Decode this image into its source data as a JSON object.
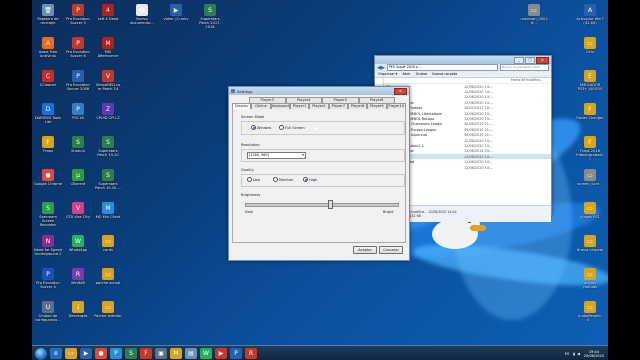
{
  "desktop": {
    "icons": [
      {
        "label": "Papelera de reciclaje",
        "glyph": "🗑",
        "color": "#6a8fb8"
      },
      {
        "label": "Avast Free Antivirus",
        "glyph": "A",
        "color": "#e86a1a"
      },
      {
        "label": "CCleaner",
        "glyph": "C",
        "color": "#c92a2a"
      },
      {
        "label": "DAEMON Tools Lite",
        "glyph": "D",
        "color": "#1d6fd8"
      },
      {
        "label": "Fraps",
        "glyph": "F",
        "color": "#d8a31d"
      },
      {
        "label": "Google Chrome",
        "glyph": "●",
        "color": "#e04a3a"
      },
      {
        "label": "Ssecream Screen Recorder",
        "glyph": "S",
        "color": "#2e9c4c"
      },
      {
        "label": "Need for Speed Underground 2",
        "glyph": "N",
        "color": "#8b2b8b"
      },
      {
        "label": "Pro Evolution Soccer 4",
        "glyph": "P",
        "color": "#1d4fb8"
      },
      {
        "label": "Unidad de configuracio...",
        "glyph": "U",
        "color": "#5a6f8a"
      },
      {
        "label": "Pro Evolution Soccer 5",
        "glyph": "P",
        "color": "#c0392b"
      },
      {
        "label": "Pro Evolution Soccer 6",
        "glyph": "P",
        "color": "#c0392b"
      },
      {
        "label": "Pro Evolution Soccer 2008",
        "glyph": "P",
        "color": "#2a5fb0"
      },
      {
        "label": "PSC16",
        "glyph": "P",
        "color": "#3a7ac0"
      },
      {
        "label": "Shotcut",
        "glyph": "S",
        "color": "#2f7d4f"
      },
      {
        "label": "uTorrent",
        "glyph": "µ",
        "color": "#2f9c3c"
      },
      {
        "label": "GTA Vice City",
        "glyph": "V",
        "color": "#d63c8f"
      },
      {
        "label": "WhatsApp",
        "glyph": "W",
        "color": "#25b05a"
      },
      {
        "label": "WinRAR",
        "glyph": "R",
        "color": "#7a3ab0"
      },
      {
        "label": "Descargas",
        "glyph": "↓",
        "color": "#d8a31d"
      },
      {
        "label": "Left 4 Dead",
        "glyph": "4",
        "color": "#b02020"
      },
      {
        "label": "MSI Afterburner",
        "glyph": "M",
        "color": "#b02020"
      },
      {
        "label": "VirtualRED.com Patch 14",
        "glyph": "V",
        "color": "#c0392b"
      },
      {
        "label": "CPUID CPU-Z",
        "glyph": "Z",
        "color": "#5a3ab0"
      },
      {
        "label": "Superstars Patch 19-20",
        "glyph": "S",
        "color": "#2f7d4f"
      },
      {
        "label": "Superstars Patch 19-20 ...",
        "glyph": "S",
        "color": "#2f7d4f"
      },
      {
        "label": "MO Mix Client",
        "glyph": "M",
        "color": "#2a8fd8"
      },
      {
        "label": "cards",
        "glyph": "▭",
        "color": "#d8a31d"
      },
      {
        "label": "parche actual",
        "glyph": "▭",
        "color": "#d8a31d"
      },
      {
        "label": "Parche anterior",
        "glyph": "▭",
        "color": "#d8a31d"
      },
      {
        "label": "Nuevo documento...",
        "glyph": "▤",
        "color": "#e8e8e8"
      },
      {
        "label": "video (1).mkv",
        "glyph": "▶",
        "color": "#2a5fb0"
      },
      {
        "label": "Superstars Patch 2017-2018",
        "glyph": "S",
        "color": "#2f7d4f"
      },
      {
        "label": "unknown_00026...",
        "glyph": "▭",
        "color": "#8a8a8a"
      },
      {
        "label": "Activador Win7 (32-64)",
        "glyph": "A",
        "color": "#2a5fb0"
      },
      {
        "label": "Celu",
        "glyph": "▭",
        "color": "#d8a31d"
      },
      {
        "label": "EMULADOR PS3+ JUEGOS",
        "glyph": "E",
        "color": "#d8a31d"
      },
      {
        "label": "Folder Changer",
        "glyph": "F",
        "color": "#d8a31d"
      },
      {
        "label": "Fraps 2018 Ribbongrabadi...",
        "glyph": "F",
        "color": "#d8a31d"
      },
      {
        "label": "screen_Scre...",
        "glyph": "▭",
        "color": "#8a8a8a"
      },
      {
        "label": "Juegos PS1",
        "glyph": "▭",
        "color": "#d8a31d"
      },
      {
        "label": "Nueva carpeta",
        "glyph": "▭",
        "color": "#d8a31d"
      },
      {
        "label": "arenas youtube",
        "glyph": "▭",
        "color": "#d8a31d"
      },
      {
        "label": "AudioReader-0...",
        "glyph": "▭",
        "color": "#d8a31d"
      }
    ]
  },
  "settings_window": {
    "title": "Settings",
    "tabs_row1": [
      "Player3",
      "Player4",
      "Player5",
      "Player6"
    ],
    "tabs_row2": [
      "Display",
      "Online",
      "keyboard",
      "Player1",
      "Player2",
      "Player7",
      "Player8",
      "Player9",
      "Player10"
    ],
    "screen_mode": {
      "label": "Screen Mode",
      "options": [
        "Window",
        "Full Screen"
      ],
      "selected": 0
    },
    "resolution": {
      "label": "Resolution",
      "value": "1280, 960"
    },
    "quality": {
      "label": "Quality",
      "options": [
        "Low",
        "Medium",
        "High"
      ],
      "selected": 2
    },
    "brightness": {
      "label": "Brightness",
      "min_label": "Dark",
      "max_label": "Bright",
      "value": 0.55
    },
    "buttons": {
      "ok": "Aceptar",
      "cancel": "Cancelar"
    }
  },
  "explorer": {
    "path": "PES Suple 2020 ▸ ...",
    "search_placeholder": "Buscar Suplemento 2020",
    "toolbar": [
      "Organizar ▾",
      "Abrir",
      "Grabar",
      "Nueva carpeta"
    ],
    "column_header": "Fecha de modifica...",
    "files": [
      {
        "name": "download",
        "date": "12/06/2020 14:..."
      },
      {
        "name": "images",
        "date": "12/06/2020 14:..."
      },
      {
        "name": "Kitserver",
        "date": "12/06/2020 14:..."
      },
      {
        "name": "Secret Editor",
        "date": "12/06/2020 14:..."
      },
      {
        "name": "Instalador Trofeos",
        "date": "16/07/2017 10:..."
      },
      {
        "name": "MOD CONMEBOL Libertadores",
        "date": "12/06/2020 14:..."
      },
      {
        "name": "MOD CONMEBOL Recopa",
        "date": "12/06/2020 14:..."
      },
      {
        "name": "MOD UEFA Champions League",
        "date": "30/06/2019 21:..."
      },
      {
        "name": "MOD UEFA Europa League",
        "date": "30/06/2019 21:..."
      },
      {
        "name": "MOD UEFA Supercup",
        "date": "30/06/2019 21:..."
      },
      {
        "name": "pesti",
        "date": "12/06/2020 14:..."
      },
      {
        "name": "PES6Resolution2.2",
        "date": "12/06/2020 14:..."
      },
      {
        "name": "Secret Editor",
        "date": "11/06/2014 03:..."
      },
      {
        "name": "settings",
        "date": "12/06/2020 14:..."
      },
      {
        "name": "unins000.dat",
        "date": "12/06/2020 14:..."
      },
      {
        "name": "unins000",
        "date": "12/06/2020 14:..."
      }
    ],
    "selected_index": 13,
    "status": {
      "line1": "Fecha de modifica... 12/06/2020 14:04",
      "line2": "Tamaño: 132 KB"
    }
  },
  "taskbar": {
    "apps": [
      {
        "glyph": "e",
        "color": "#1e6fc0"
      },
      {
        "glyph": "▭",
        "color": "#d8a31d"
      },
      {
        "glyph": "▶",
        "color": "#2a5fb0"
      },
      {
        "glyph": "●",
        "color": "#e04a3a"
      },
      {
        "glyph": "P",
        "color": "#2a8fd8"
      },
      {
        "glyph": "S",
        "color": "#2f7d4f"
      },
      {
        "glyph": "F",
        "color": "#c0392b"
      },
      {
        "glyph": "▣",
        "color": "#5a6f8a"
      },
      {
        "glyph": "M",
        "color": "#d8a31d"
      },
      {
        "glyph": "▤",
        "color": "#6a8fb8"
      },
      {
        "glyph": "W",
        "color": "#25b05a"
      },
      {
        "glyph": "▶",
        "color": "#c0392b"
      },
      {
        "glyph": "P",
        "color": "#2a5fb0"
      },
      {
        "glyph": "R",
        "color": "#c0392b"
      }
    ],
    "lang": "ES",
    "time": "19:44",
    "date": "29/06/2020"
  }
}
